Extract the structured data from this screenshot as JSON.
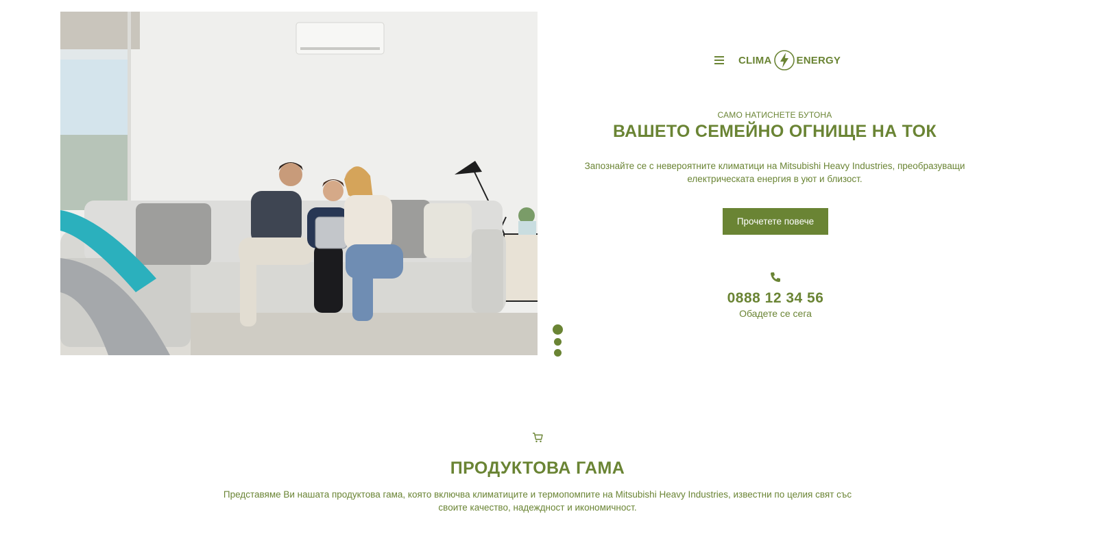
{
  "hero": {
    "image_alt": "Семейство на дивана под климатик",
    "carousel": {
      "slide_count": 3,
      "active_index": 0
    }
  },
  "header": {
    "menu_icon": "hamburger-icon",
    "logo": {
      "left": "CLIMA",
      "icon": "lightning-bolt-icon",
      "right": "ENERGY"
    }
  },
  "banner": {
    "eyebrow": "САМО НАТИСНЕТЕ БУТОНА",
    "title": "ВАШЕТО СЕМЕЙНО ОГНИЩЕ НА ТОК",
    "description": "Запознайте се с невероятните климатици на Mitsubishi Heavy Industries, преобразуващи електрическата енергия в уют и близост.",
    "cta_label": "Прочетете повече"
  },
  "contact": {
    "icon": "phone-icon",
    "phone": "0888 12 34 56",
    "caption": "Обадете се сега"
  },
  "products": {
    "icon": "cart-icon",
    "title": "ПРОДУКТОВА ГАМА",
    "description": "Представяме Ви нашата продуктова гама, която включва климатиците и термопомпите на Mitsubishi Heavy Industries, известни по целия свят със своите качество, надеждност и икономичност."
  },
  "colors": {
    "accent": "#6a8434",
    "background": "#ffffff"
  }
}
